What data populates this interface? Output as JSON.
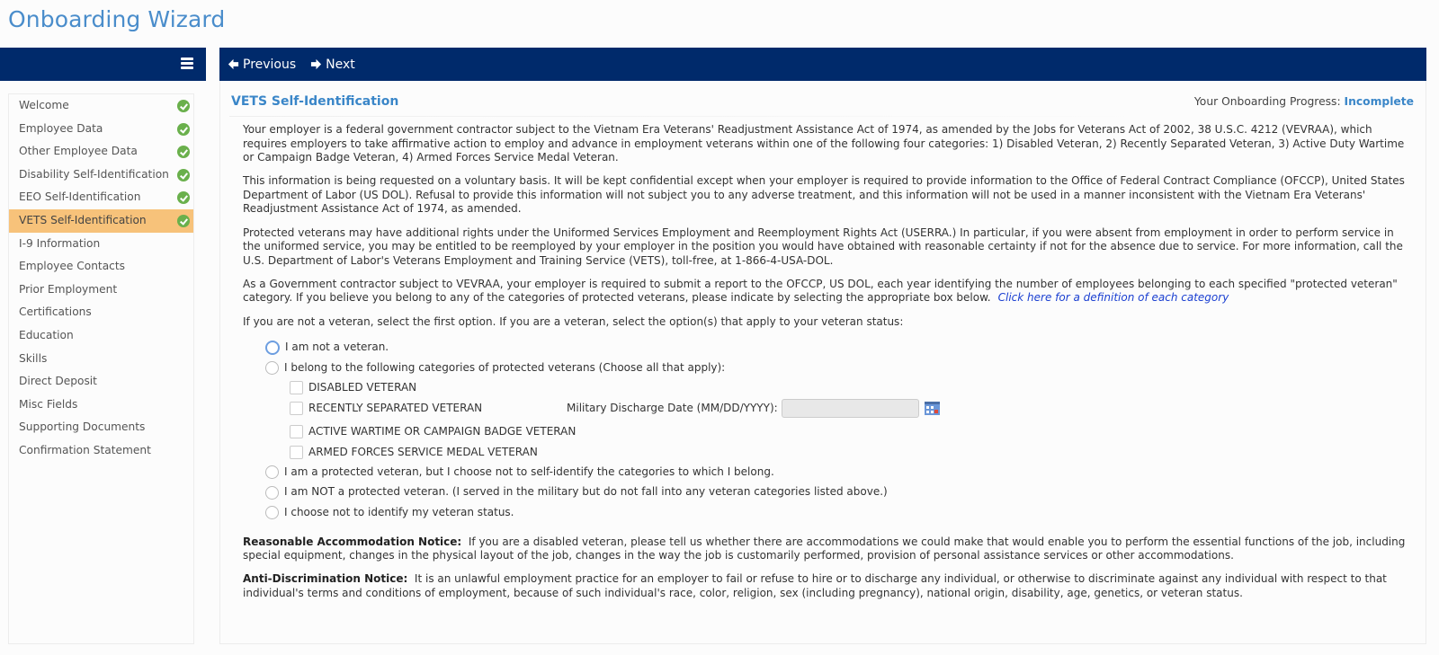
{
  "app": {
    "title": "Onboarding Wizard"
  },
  "sidebar": {
    "menu_icon": "hamburger-menu-icon",
    "items": [
      {
        "label": "Welcome",
        "completed": true,
        "active": false
      },
      {
        "label": "Employee Data",
        "completed": true,
        "active": false
      },
      {
        "label": "Other Employee Data",
        "completed": true,
        "active": false
      },
      {
        "label": "Disability Self-Identification",
        "completed": true,
        "active": false
      },
      {
        "label": "EEO Self-Identification",
        "completed": true,
        "active": false
      },
      {
        "label": "VETS Self-Identification",
        "completed": true,
        "active": true
      },
      {
        "label": "I-9 Information",
        "completed": false,
        "active": false
      },
      {
        "label": "Employee Contacts",
        "completed": false,
        "active": false
      },
      {
        "label": "Prior Employment",
        "completed": false,
        "active": false
      },
      {
        "label": "Certifications",
        "completed": false,
        "active": false
      },
      {
        "label": "Education",
        "completed": false,
        "active": false
      },
      {
        "label": "Skills",
        "completed": false,
        "active": false
      },
      {
        "label": "Direct Deposit",
        "completed": false,
        "active": false
      },
      {
        "label": "Misc Fields",
        "completed": false,
        "active": false
      },
      {
        "label": "Supporting Documents",
        "completed": false,
        "active": false
      },
      {
        "label": "Confirmation Statement",
        "completed": false,
        "active": false
      }
    ]
  },
  "toolbar": {
    "previous_label": "Previous",
    "next_label": "Next"
  },
  "page": {
    "section_title": "VETS Self-Identification",
    "progress_label": "Your Onboarding Progress:",
    "progress_status": "Incomplete",
    "paragraphs": [
      "Your employer is a federal government contractor subject to the Vietnam Era Veterans' Readjustment Assistance Act of 1974, as amended by the Jobs for Veterans Act of 2002, 38 U.S.C. 4212 (VEVRAA), which requires employers to take affirmative action to employ and advance in employment veterans within one of the following four categories: 1) Disabled Veteran, 2) Recently Separated Veteran, 3) Active Duty Wartime or Campaign Badge Veteran, 4) Armed Forces Service Medal Veteran.",
      "This information is being requested on a voluntary basis. It will be kept confidential except when your employer is required to provide information to the Office of Federal Contract Compliance (OFCCP), United States Department of Labor (US DOL). Refusal to provide this information will not subject you to any adverse treatment, and this information will not be used in a manner inconsistent with the Vietnam Era Veterans' Readjustment Assistance Act of 1974, as amended.",
      "Protected veterans may have additional rights under the Uniformed Services Employment and Reemployment Rights Act (USERRA.) In particular, if you were absent from employment in order to perform service in the uniformed service, you may be entitled to be reemployed by your employer in the position you would have obtained with reasonable certainty if not for the absence due to service. For more information, call the U.S. Department of Labor's Veterans Employment and Training Service (VETS), toll-free, at 1-866-4-USA-DOL.",
      "As a Government contractor subject to VEVRAA, your employer is required to submit a report to the OFCCP, US DOL, each year identifying the number of employees belonging to each specified \"protected veteran\" category. If you believe you belong to any of the categories of protected veterans, please indicate by selecting the appropriate box below."
    ],
    "definition_link": "Click here for a definition of each category",
    "instruction": "If you are not a veteran, select the first option. If you are a veteran, select the option(s) that apply to your veteran status:",
    "options": {
      "not_veteran": "I am not a veteran.",
      "belong_categories": "I belong to the following categories of protected veterans (Choose all that apply):",
      "categories": [
        "DISABLED VETERAN",
        "RECENTLY SEPARATED VETERAN",
        "ACTIVE WARTIME OR CAMPAIGN BADGE VETERAN",
        "ARMED FORCES SERVICE MEDAL VETERAN"
      ],
      "protected_no_identify": "I am a protected veteran, but I choose not to self-identify the categories to which I belong.",
      "not_protected": "I am NOT a protected veteran. (I served in the military but do not fall into any veteran categories listed above.)",
      "choose_not": "I choose not to identify my veteran status."
    },
    "discharge_date": {
      "label": "Military Discharge Date (MM/DD/YYYY):",
      "value": "",
      "placeholder": ""
    },
    "accommodation_notice": {
      "title": "Reasonable Accommodation Notice:",
      "text": "If you are a disabled veteran, please tell us whether there are accommodations we could make that would enable you to perform the essential functions of the job, including special equipment, changes in the physical layout of the job, changes in the way the job is customarily performed, provision of personal assistance services or other accommodations."
    },
    "discrimination_notice": {
      "title": "Anti-Discrimination Notice:",
      "text": "It is an unlawful employment practice for an employer to fail or refuse to hire or to discharge any individual, or otherwise to discriminate against any individual with respect to that individual's terms and conditions of employment, because of such individual's race, color, religion, sex (including pregnancy), national origin, disability, age, genetics, or veteran status."
    }
  },
  "colors": {
    "header_bg": "#002a6b",
    "accent_blue": "#3a86c8",
    "active_item": "#f7c27a",
    "check_green": "#6ab04c",
    "link": "#1a3fd1"
  }
}
